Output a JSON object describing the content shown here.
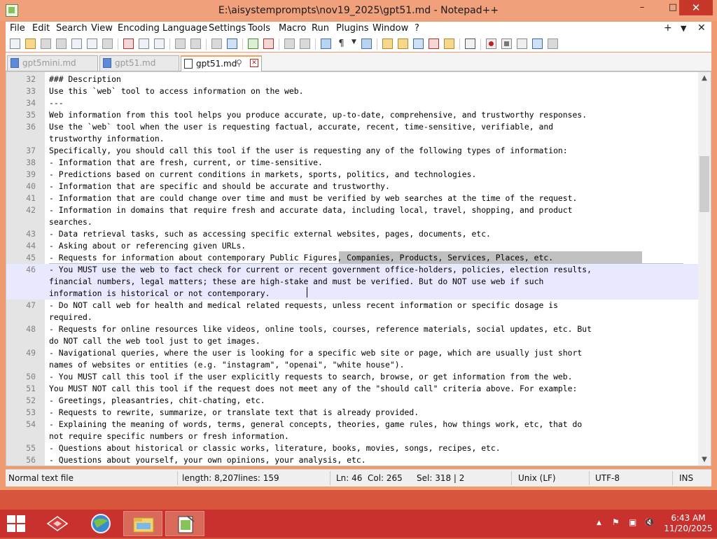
{
  "window": {
    "title": "E:\\aisystemprompts\\nov19_2025\\gpt51.md - Notepad++",
    "minimize": "–",
    "maximize": "□",
    "close": "✕"
  },
  "menu": [
    "File",
    "Edit",
    "Search",
    "View",
    "Encoding",
    "Language",
    "Settings",
    "Tools",
    "Macro",
    "Run",
    "Plugins",
    "Window",
    "?"
  ],
  "menu_right": {
    "plus": "+",
    "dropdown": "▼",
    "close": "✕"
  },
  "tabs": [
    {
      "label": "gpt5mini.md",
      "active": false
    },
    {
      "label": "gpt51.md",
      "active": false
    },
    {
      "label": "gpt51.md",
      "active": true,
      "pin": "📌"
    }
  ],
  "editor": {
    "lines": [
      {
        "n": "32",
        "text": "### Description"
      },
      {
        "n": "33",
        "text": "Use this `web` tool to access information on the web."
      },
      {
        "n": "34",
        "text": "---"
      },
      {
        "n": "35",
        "text": "Web information from this tool helps you produce accurate, up-to-date, comprehensive, and trustworthy responses."
      },
      {
        "n": "36",
        "text": "Use the `web` tool when the user is requesting factual, accurate, recent, time-sensitive, verifiable, and"
      },
      {
        "n": "",
        "text": "trustworthy information."
      },
      {
        "n": "37",
        "text": "Specifically, you should call this tool if the user is requesting any of the following types of information:"
      },
      {
        "n": "38",
        "text": "- Information that are fresh, current, or time-sensitive."
      },
      {
        "n": "39",
        "text": "- Predictions based on current conditions in markets, sports, politics, and technologies."
      },
      {
        "n": "40",
        "text": "- Information that are specific and should be accurate and trustworthy."
      },
      {
        "n": "41",
        "text": "- Information that are could change over time and must be verified by web searches at the time of the request."
      },
      {
        "n": "42",
        "text": "- Information in domains that require fresh and accurate data, including local, travel, shopping, and product"
      },
      {
        "n": "",
        "text": "searches."
      },
      {
        "n": "43",
        "text": "- Data retrieval tasks, such as accessing specific external websites, pages, documents, etc."
      },
      {
        "n": "44",
        "text": "- Asking about or referencing given URLs."
      },
      {
        "n": "45",
        "text": "- Requests for information about contemporary Public Figures, Companies, Products, Services, Places, etc."
      },
      {
        "n": "46",
        "text": "- You MUST use the web to fact check for current or recent government office-holders, policies, election results,"
      },
      {
        "n": "",
        "text": "financial numbers, legal matters; these are high-stake and must be verified. But do NOT use web if such"
      },
      {
        "n": "",
        "text": "information is historical or not contemporary."
      },
      {
        "n": "47",
        "text": "- Do NOT call web for health and medical related requests, unless recent information or specific dosage is"
      },
      {
        "n": "",
        "text": "required."
      },
      {
        "n": "48",
        "text": "- Requests for online resources like videos, online tools, courses, reference materials, social updates, etc. But"
      },
      {
        "n": "",
        "text": "do NOT call the web tool just to get images."
      },
      {
        "n": "49",
        "text": "- Navigational queries, where the user is looking for a specific web site or page, which are usually just short"
      },
      {
        "n": "",
        "text": "names of websites or entities (e.g. \"instagram\", \"openai\", \"white house\")."
      },
      {
        "n": "50",
        "text": "- You MUST call this tool if the user explicitly requests to search, browse, or get information from the web."
      },
      {
        "n": "51",
        "text": "You MUST NOT call this tool if the request does not meet any of the \"should call\" criteria above. For example:"
      },
      {
        "n": "52",
        "text": "- Greetings, pleasantries, chit-chating, etc."
      },
      {
        "n": "53",
        "text": "- Requests to rewrite, summarize, or translate text that is already provided."
      },
      {
        "n": "54",
        "text": "- Explaining the meaning of words, terms, general concepts, theories, game rules, how things work, etc, that do"
      },
      {
        "n": "",
        "text": "not require specific numbers or fresh information."
      },
      {
        "n": "55",
        "text": "- Questions about historical or classic works, literature, books, movies, songs, recipes, etc."
      },
      {
        "n": "56",
        "text": "- Questions about yourself, your own opinions, your analysis, etc."
      }
    ]
  },
  "status": {
    "file_type": "Normal text file",
    "length": "length: 8,207",
    "lines": "lines: 159",
    "ln": "Ln: 46",
    "col": "Col: 265",
    "sel": "Sel: 318 | 2",
    "eol": "Unix (LF)",
    "encoding": "UTF-8",
    "mode": "INS"
  },
  "taskbar": {
    "time": "6:43 AM",
    "date": "11/20/2025"
  }
}
